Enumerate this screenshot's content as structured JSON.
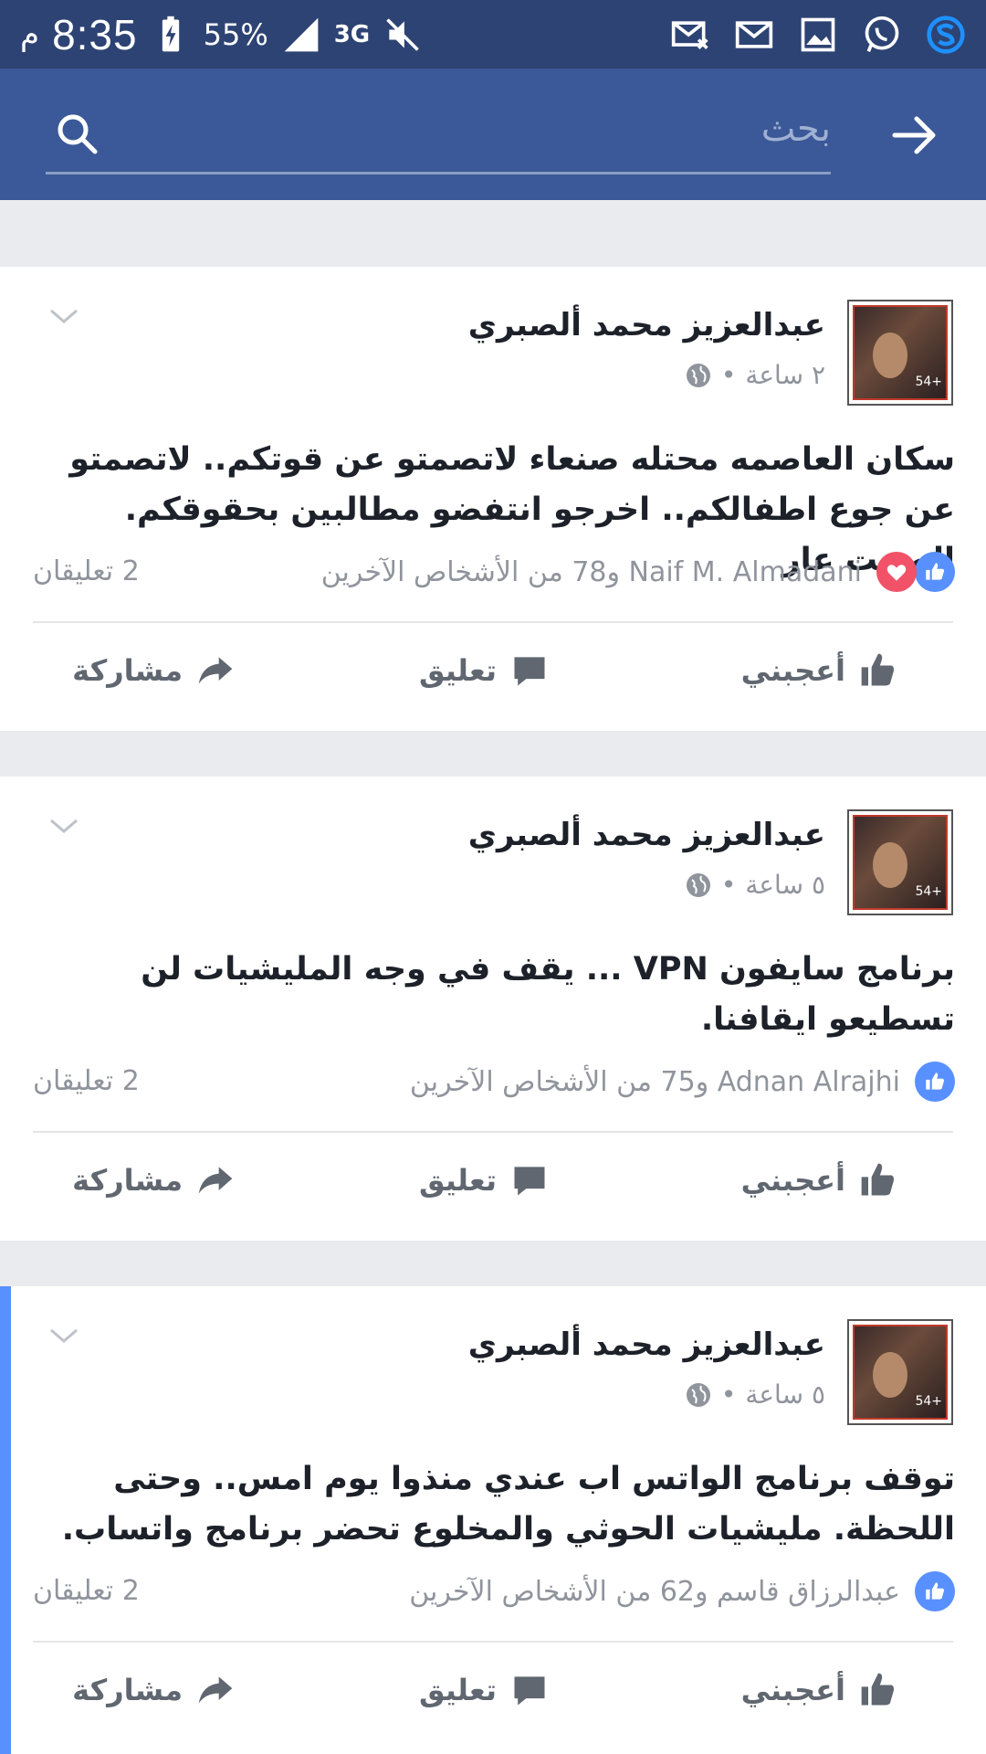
{
  "status_bar": {
    "ampm": "م",
    "time": "8:35",
    "battery": "55%",
    "network": "3G"
  },
  "search": {
    "placeholder": "بحث"
  },
  "actions": {
    "like": "أعجبني",
    "comment": "تعليق",
    "share": "مشاركة"
  },
  "posts": [
    {
      "author": "عبدالعزيز محمد ألصبري",
      "time": "٢ ساعة",
      "text": "سكان العاصمه محتله صنعاء لاتصمتو  عن قوتكم.. لاتصمتو عن جوع اطفالكم.. اخرجو انتفضو مطالبين بحقوقكم. الصمت عار",
      "reactors": "Naif M. Almadani و78 من الأشخاص الآخرين",
      "comments": "2 تعليقان",
      "has_love": true
    },
    {
      "author": "عبدالعزيز محمد ألصبري",
      "time": "٥ ساعة",
      "text": "برنامج سايفون VPN ...  يقف في وجه المليشيات لن تسطيعو ايقافنا.",
      "reactors": "Adnan Alrajhi و75 من الأشخاص الآخرين",
      "comments": "2 تعليقان",
      "has_love": false
    },
    {
      "author": "عبدالعزيز محمد ألصبري",
      "time": "٥ ساعة",
      "text": "توقف برنامج الواتس اب عندي منذوا يوم امس.. وحتى اللحظة. مليشيات الحوثي والمخلوع تحضر برنامج واتساب.",
      "reactors": "عبدالرزاق قاسم و62 من الأشخاص الآخرين",
      "comments": "2 تعليقان",
      "has_love": false
    }
  ]
}
